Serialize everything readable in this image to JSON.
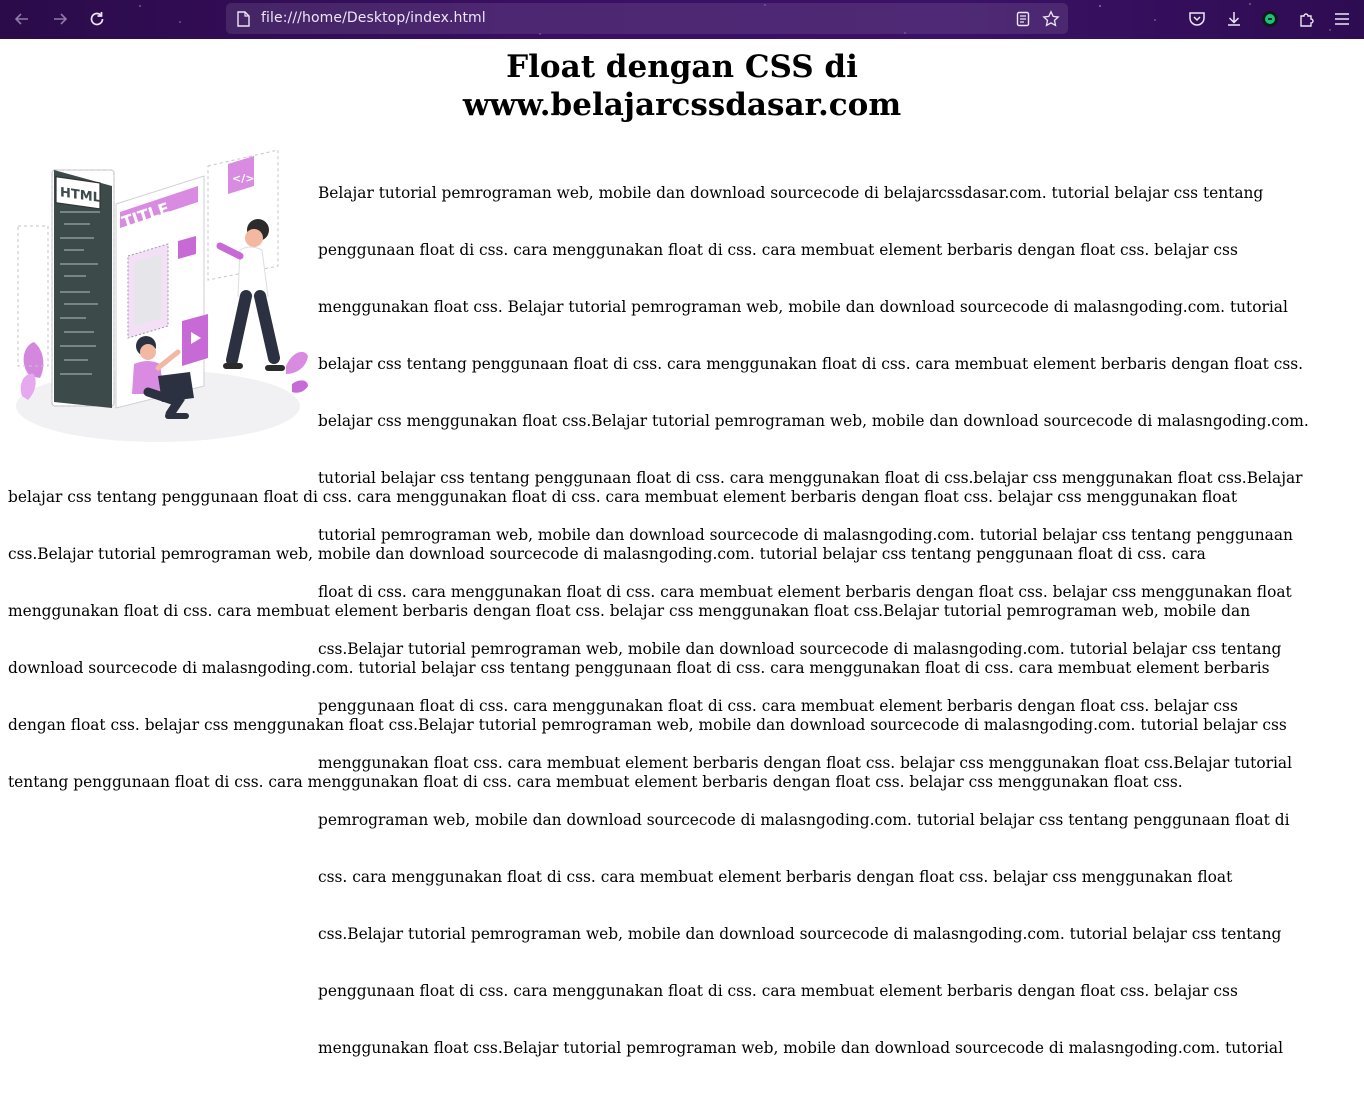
{
  "browser": {
    "url": "file:///home/Desktop/index.html",
    "icons": {
      "back": "back-arrow-icon",
      "forward": "forward-arrow-icon",
      "reload": "reload-icon",
      "page": "page-icon",
      "reader": "reader-view-icon",
      "bookmark": "bookmark-star-icon",
      "pocket": "pocket-icon",
      "downloads": "download-icon",
      "account": "extension-icon",
      "extensions": "puzzle-icon",
      "menu": "hamburger-menu-icon"
    },
    "theme": {
      "toolbar": "#3a0f63"
    }
  },
  "page": {
    "title_line1": "Float dengan CSS di",
    "title_line2": "www.belajarcssdasar.com",
    "paragraph_lines": [
      "Belajar tutorial pemrograman web, mobile dan download sourcecode di belajarcssdasar.com. tutorial belajar css tentang",
      "penggunaan float di css. cara menggunakan float di css. cara membuat element berbaris dengan float css. belajar css",
      "menggunakan float css. Belajar tutorial pemrograman web, mobile dan download sourcecode di malasngoding.com. tutorial",
      "belajar css tentang penggunaan float di css. cara menggunakan float di css. cara membuat element berbaris dengan float css.",
      "belajar css menggunakan float css.Belajar tutorial pemrograman web, mobile dan download sourcecode di malasngoding.com.",
      "tutorial belajar css tentang penggunaan float di css. cara menggunakan float di css.belajar css menggunakan float css.Belajar",
      "tutorial pemrograman web, mobile dan download sourcecode di malasngoding.com. tutorial belajar css tentang penggunaan",
      "float di css. cara menggunakan float di css. cara membuat element berbaris dengan float css. belajar css menggunakan float",
      "css.Belajar tutorial pemrograman web, mobile dan download sourcecode di malasngoding.com. tutorial belajar css tentang",
      "penggunaan float di css. cara menggunakan float di css. cara membuat element berbaris dengan float css. belajar css",
      "menggunakan float css. cara membuat element berbaris dengan float css. belajar css menggunakan float css.Belajar tutorial",
      "pemrograman web, mobile dan download sourcecode di malasngoding.com. tutorial belajar css tentang penggunaan float di",
      "css. cara menggunakan float di css. cara membuat element berbaris dengan float css. belajar css menggunakan float",
      "css.Belajar tutorial pemrograman web, mobile dan download sourcecode di malasngoding.com. tutorial belajar css tentang",
      "penggunaan float di css. cara menggunakan float di css. cara membuat element berbaris dengan float css. belajar css",
      "menggunakan float css.Belajar tutorial pemrograman web, mobile dan download sourcecode di malasngoding.com. tutorial"
    ],
    "paragraph_bottom_lines": [
      "belajar css tentang penggunaan float di css. cara menggunakan float di css. cara membuat element berbaris dengan float css. belajar css menggunakan float",
      "css.Belajar tutorial pemrograman web, mobile dan download sourcecode di malasngoding.com. tutorial belajar css tentang penggunaan float di css. cara",
      "menggunakan float di css. cara membuat element berbaris dengan float css. belajar css menggunakan float css.Belajar tutorial pemrograman web, mobile dan",
      "download sourcecode di malasngoding.com. tutorial belajar css tentang penggunaan float di css. cara menggunakan float di css. cara membuat element berbaris",
      "dengan float css. belajar css menggunakan float css.Belajar tutorial pemrograman web, mobile dan download sourcecode di malasngoding.com. tutorial belajar css",
      "tentang penggunaan float di css. cara menggunakan float di css. cara membuat element berbaris dengan float css. belajar css menggunakan float css."
    ],
    "illustration": {
      "html_tag": "HTML",
      "title_tag": "TITLE",
      "code_tag": "</>"
    }
  }
}
